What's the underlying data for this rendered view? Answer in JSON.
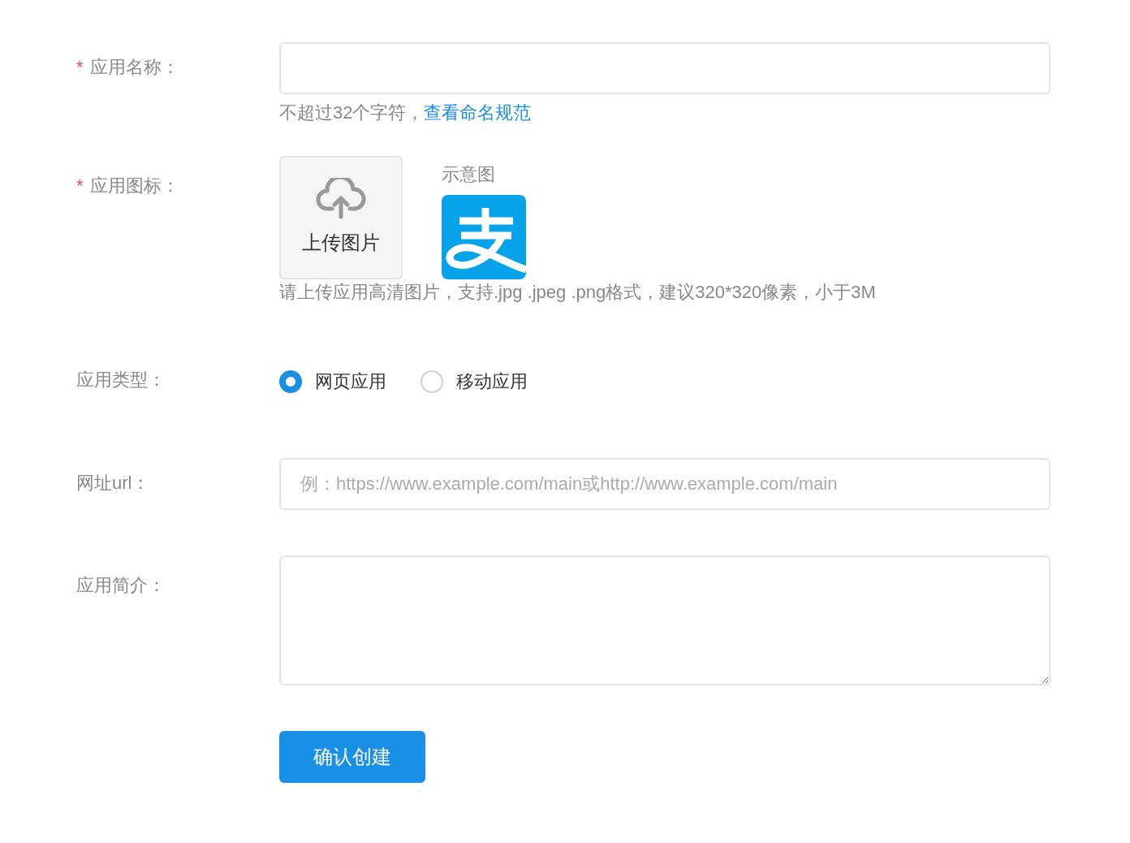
{
  "name_field": {
    "label": "应用名称：",
    "required_mark": "*",
    "hint": "不超过32个字符，",
    "link": "查看命名规范"
  },
  "icon_field": {
    "label": "应用图标：",
    "required_mark": "*",
    "upload_label": "上传图片",
    "example_caption": "示意图",
    "hint": "请上传应用高清图片，支持.jpg .jpeg .png格式，建议320*320像素，小于3M"
  },
  "type_field": {
    "label": "应用类型：",
    "options": [
      {
        "label": "网页应用",
        "selected": true
      },
      {
        "label": "移动应用",
        "selected": false
      }
    ]
  },
  "url_field": {
    "label": "网址url：",
    "placeholder": "例：https://www.example.com/main或http://www.example.com/main"
  },
  "intro_field": {
    "label": "应用简介："
  },
  "submit": "确认创建"
}
